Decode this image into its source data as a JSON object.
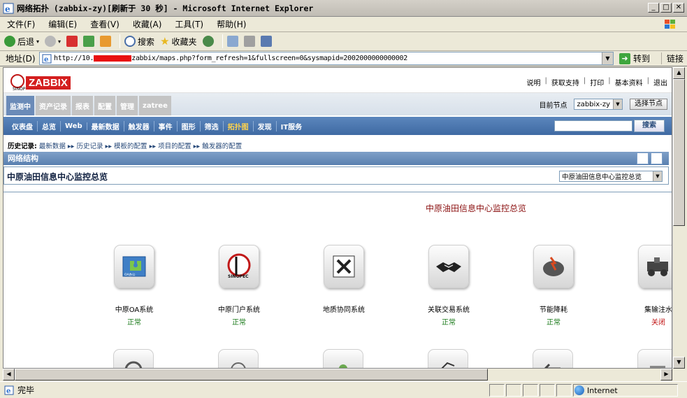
{
  "window": {
    "title": "网络拓扑 (zabbix-zy)[刷新于 30 秒] - Microsoft Internet Explorer"
  },
  "menu": [
    "文件(F)",
    "编辑(E)",
    "查看(V)",
    "收藏(A)",
    "工具(T)",
    "帮助(H)"
  ],
  "toolbar": {
    "back": "后退",
    "search": "搜索",
    "favorites": "收藏夹"
  },
  "address": {
    "label": "地址(D)",
    "url_prefix": "http://10.",
    "url_suffix": "zabbix/maps.php?form_refresh=1&fullscreen=0&sysmapid=2002000000000002",
    "go": "转到",
    "links": "链接"
  },
  "status": {
    "text": "完毕",
    "zone": "Internet"
  },
  "zabbix": {
    "logo": "ZABBIX",
    "top_links": [
      "说明",
      "获取支持",
      "打印",
      "基本资料",
      "退出"
    ],
    "main_tabs": [
      {
        "label": "监测中",
        "active": true
      },
      {
        "label": "资产记录",
        "active": false
      },
      {
        "label": "报表",
        "active": false
      },
      {
        "label": "配置",
        "active": false
      },
      {
        "label": "管理",
        "active": false
      },
      {
        "label": "zatree",
        "active": false
      }
    ],
    "node_label": "目前节点",
    "node_value": "zabbix-zy",
    "node_button": "选择节点",
    "sub_menu": [
      {
        "label": "仪表盘",
        "active": false
      },
      {
        "label": "总览",
        "active": false
      },
      {
        "label": "Web",
        "active": false
      },
      {
        "label": "最新数据",
        "active": false
      },
      {
        "label": "触发器",
        "active": false
      },
      {
        "label": "事件",
        "active": false
      },
      {
        "label": "图形",
        "active": false
      },
      {
        "label": "筛选",
        "active": false
      },
      {
        "label": "拓扑图",
        "active": true
      },
      {
        "label": "发现",
        "active": false
      },
      {
        "label": "IT服务",
        "active": false
      }
    ],
    "search_button": "搜索",
    "history_label": "历史记录:",
    "history": [
      "最新数据",
      "历史记录",
      "模板的配置",
      "项目的配置",
      "触发器的配置"
    ],
    "section_title": "网络结构",
    "map_header_title": "中原油田信息中心监控总览",
    "map_select": "中原油田信息中心监控总览",
    "map_title": "中原油田信息中心监控总览",
    "nodes": [
      {
        "name": "中原OA系统",
        "status": "正常",
        "icon": "oa-puzzle-icon",
        "ok": true
      },
      {
        "name": "中原门户系统",
        "status": "正常",
        "icon": "sinopec-logo-icon",
        "ok": true
      },
      {
        "name": "地质协同系统",
        "status": "",
        "icon": "tools-icon",
        "ok": true
      },
      {
        "name": "关联交易系统",
        "status": "正常",
        "icon": "handshake-icon",
        "ok": true
      },
      {
        "name": "节能降耗",
        "status": "正常",
        "icon": "energy-icon",
        "ok": true
      },
      {
        "name": "集输注水",
        "status": "关闭",
        "icon": "pump-icon",
        "ok": false
      }
    ]
  }
}
